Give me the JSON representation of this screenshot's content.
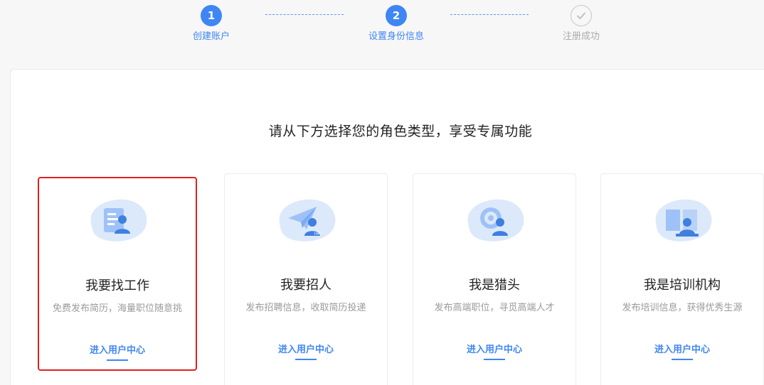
{
  "stepper": {
    "steps": [
      {
        "number": "1",
        "label": "创建账户",
        "state": "done-number"
      },
      {
        "number": "2",
        "label": "设置身份信息",
        "state": "active"
      },
      {
        "number": "",
        "label": "注册成功",
        "state": "pending",
        "icon": "check-icon"
      }
    ],
    "accent_color": "#3f86f3"
  },
  "main": {
    "headline": "请从下方选择您的角色类型，享受专属功能",
    "cards": [
      {
        "title": "我要找工作",
        "desc": "免费发布简历，海量职位随意挑",
        "link": "进入用户中心",
        "icon": "resume-user-icon",
        "selected": true
      },
      {
        "title": "我要招人",
        "desc": "发布招聘信息，收取简历投递",
        "link": "进入用户中心",
        "icon": "paper-plane-hr-icon",
        "selected": false
      },
      {
        "title": "我是猎头",
        "desc": "发布高端职位，寻觅高端人才",
        "link": "进入用户中心",
        "icon": "target-user-icon",
        "selected": false
      },
      {
        "title": "我是培训机构",
        "desc": "发布培训信息，获得优秀生源",
        "link": "进入用户中心",
        "icon": "book-teacher-icon",
        "selected": false
      }
    ],
    "selected_border_color": "#e02020"
  }
}
